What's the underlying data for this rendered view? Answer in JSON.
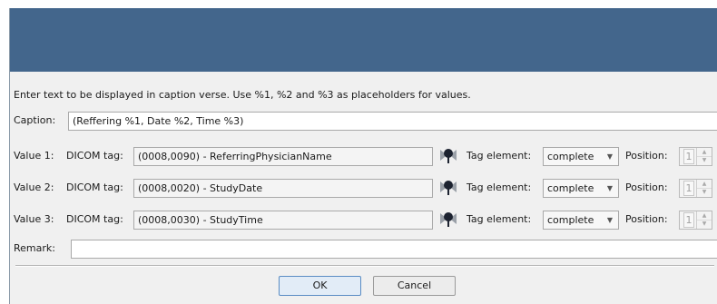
{
  "dialog": {
    "instruction": "Enter text to be displayed in caption verse. Use %1, %2 and %3 as placeholders for values.",
    "caption_label": "Caption:",
    "caption_value": "(Reffering %1, Date %2, Time %3)",
    "dicom_tag_label": "DICOM tag:",
    "tag_element_label": "Tag element:",
    "position_label": "Position:",
    "values": [
      {
        "label": "Value 1:",
        "tag": "(0008,0090) - ReferringPhysicianName",
        "element": "complete",
        "position": "1"
      },
      {
        "label": "Value 2:",
        "tag": "(0008,0020) - StudyDate",
        "element": "complete",
        "position": "1"
      },
      {
        "label": "Value 3:",
        "tag": "(0008,0030) - StudyTime",
        "element": "complete",
        "position": "1"
      }
    ],
    "remark_label": "Remark:",
    "remark_value": "",
    "ok_label": "OK",
    "cancel_label": "Cancel"
  },
  "icons": {
    "tag_picker": "map-pin-icon",
    "combo_arrow": "triangle-down-icon"
  },
  "colors": {
    "titlebar": "#43668c",
    "ok_border": "#5a8cc4"
  }
}
